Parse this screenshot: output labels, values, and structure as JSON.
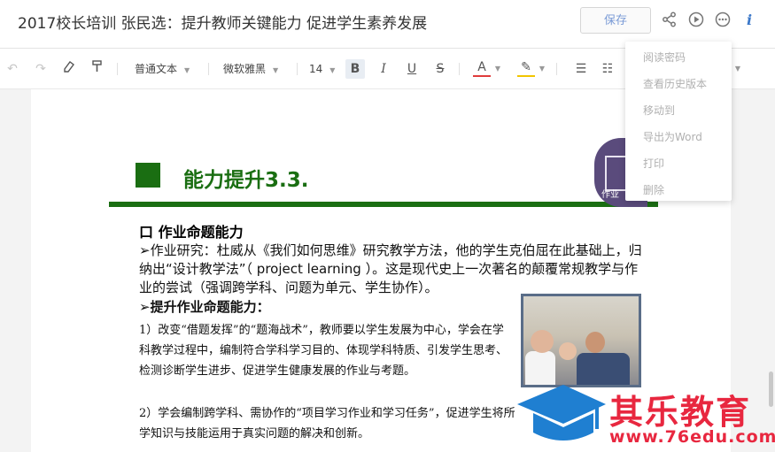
{
  "header": {
    "title": "2017校长培训   张民选：提升教师关键能力 促进学生素养发展",
    "save_label": "保存",
    "icons": [
      "share-icon",
      "play-icon",
      "more-icon",
      "info-icon"
    ]
  },
  "toolbar": {
    "undo": "↶",
    "redo": "↷",
    "eraser": "⌫",
    "format_painter": "🖌",
    "paragraph_style": "普通文本",
    "font_family": "微软雅黑",
    "font_size": "14",
    "bold": "B",
    "italic": "I",
    "underline": "U",
    "strike": "S",
    "font_color": "A",
    "highlight": "✎",
    "bullet": "☰",
    "numbered": "☷"
  },
  "menu": {
    "items": [
      "阅读密码",
      "查看历史版本",
      "移动到",
      "导出为Word",
      "打印",
      "删除"
    ]
  },
  "slide": {
    "title": "能力提升3.3.",
    "badge": "作业",
    "heading": "口 作业命题能力",
    "para1": "➢作业研究：杜威从《我们如何思维》研究教学方法，他的学生克伯屈在此基础上，归纳出“设计教学法”（ project learning ）。这是现代史上一次著名的颠覆常规教学与作业的尝试（强调跨学科、问题为单元、学生协作）。",
    "subheading": "➢提升作业命题能力：",
    "para2": "1）改变“借题发挥”的“题海战术”，教师要以学生发展为中心，学会在学科教学过程中，编制符合学科学习目的、体现学科特质、引发学生思考、检测诊断学生进步、促进学生健康发展的作业与考题。",
    "para3": "2）学会编制跨学科、需协作的“项目学习作业和学习任务”，促进学生将所学知识与技能运用于真实问题的解决和创新。"
  },
  "watermark": {
    "brand": "其乐教育",
    "url": "www.76edu.com"
  },
  "colors": {
    "accent_green": "#1a6e12",
    "watermark_red": "#e8273f",
    "watermark_blue": "#1f7fd1"
  }
}
